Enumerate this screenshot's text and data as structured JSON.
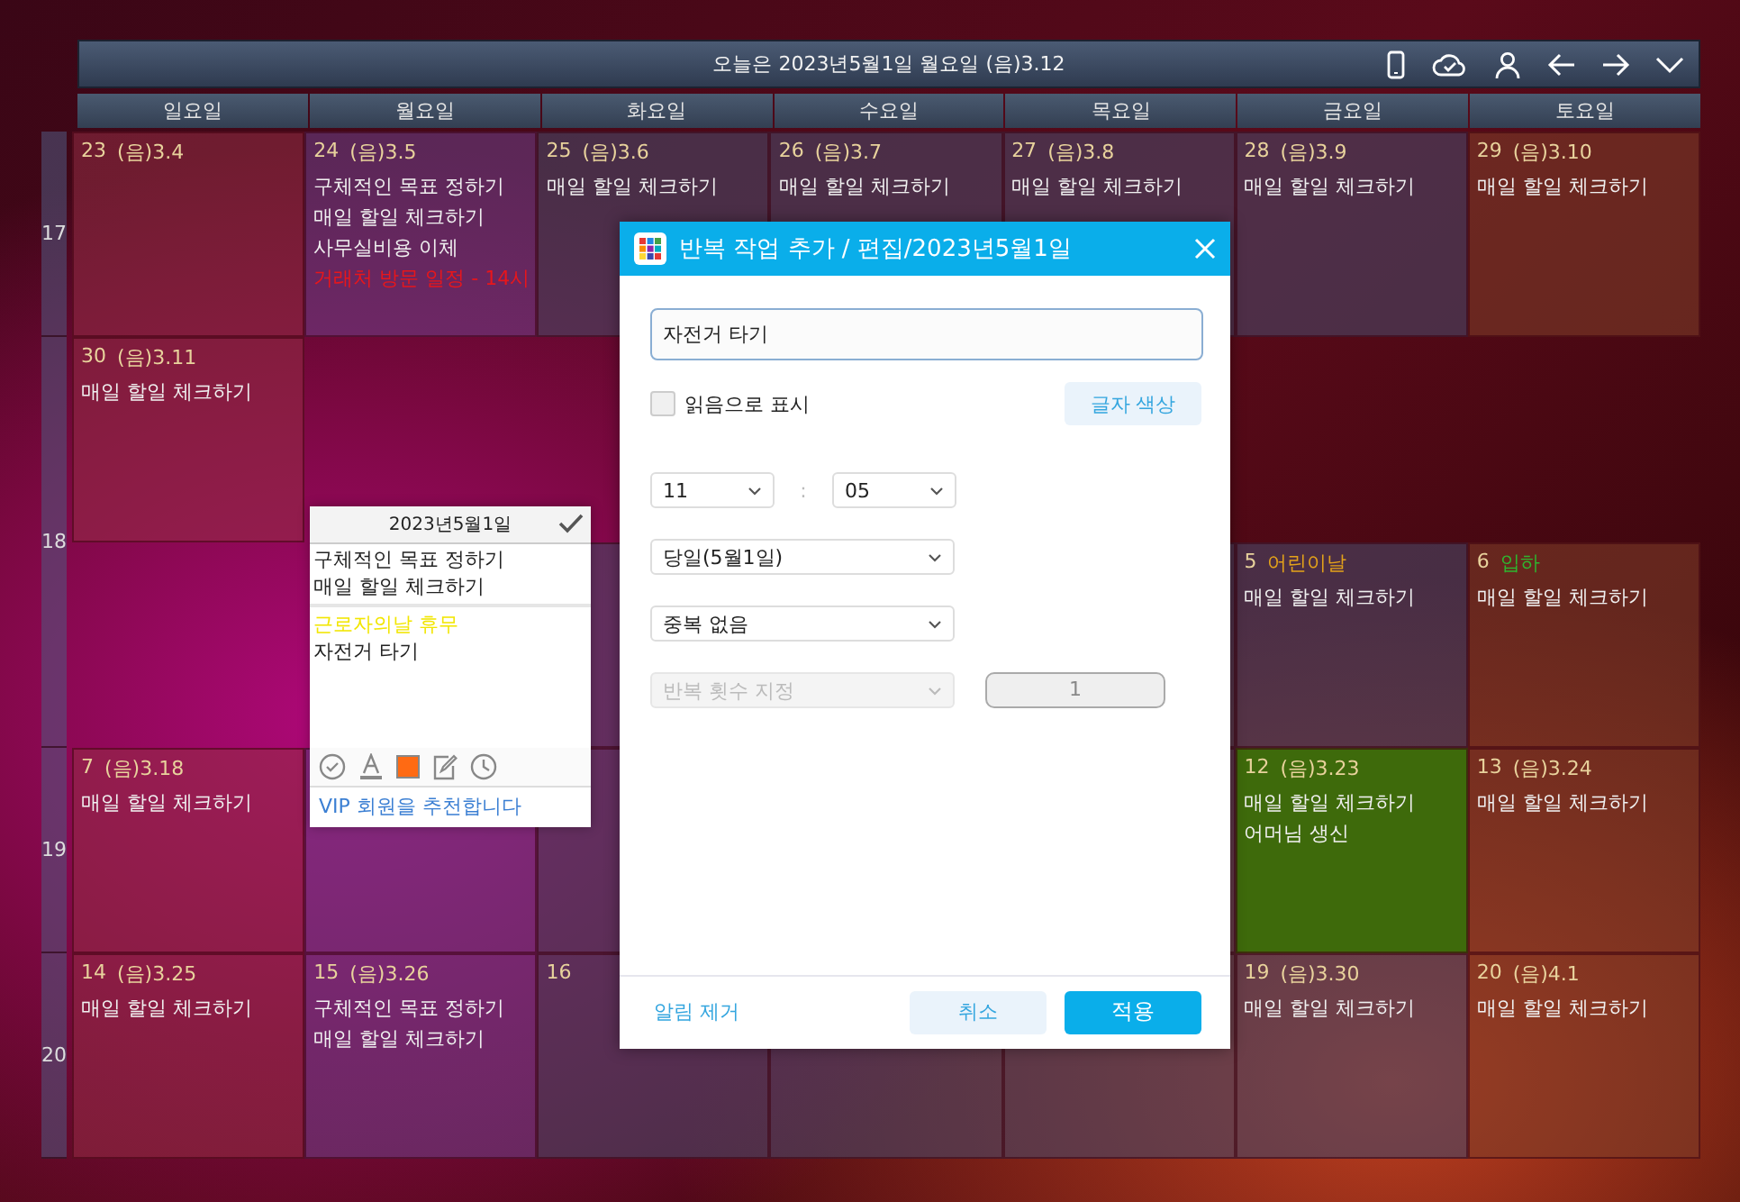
{
  "top_bar": {
    "title": "오늘은 2023년5월1일 월요일 (음)3.12"
  },
  "weekdays": [
    "일요일",
    "월요일",
    "화요일",
    "수요일",
    "목요일",
    "금요일",
    "토요일"
  ],
  "weeks": [
    {
      "number": "17",
      "rows": [
        [
          {
            "kind": "sun",
            "day": "23",
            "sub": "(음)3.4"
          },
          {
            "kind": "mon",
            "day": "24",
            "sub": "(음)3.5",
            "entries": [
              {
                "text": "구체적인 목표 정하기"
              },
              {
                "text": "매일 할일 체크하기"
              },
              {
                "text": "사무실비용 이체"
              },
              {
                "text": "거래처 방문 일정 - 14시",
                "color": "#e8161b"
              }
            ]
          },
          {
            "kind": "mid",
            "day": "25",
            "sub": "(음)3.6",
            "entries": [
              {
                "text": "매일 할일 체크하기"
              }
            ]
          },
          {
            "kind": "mid",
            "day": "26",
            "sub": "(음)3.7",
            "entries": [
              {
                "text": "매일 할일 체크하기"
              }
            ]
          },
          {
            "kind": "mid",
            "day": "27",
            "sub": "(음)3.8",
            "entries": [
              {
                "text": "매일 할일 체크하기"
              }
            ]
          },
          {
            "kind": "mid",
            "day": "28",
            "sub": "(음)3.9",
            "entries": [
              {
                "text": "매일 할일 체크하기"
              }
            ]
          },
          {
            "kind": "sat",
            "day": "29",
            "sub": "(음)3.10",
            "entries": [
              {
                "text": "매일 할일 체크하기"
              }
            ]
          }
        ]
      ]
    },
    {
      "number": "18",
      "rows": [
        [
          {
            "kind": "sun",
            "day": "30",
            "sub": "(음)3.11",
            "entries": [
              {
                "text": "매일 할일 체크하기"
              }
            ]
          },
          {
            "kind": "none"
          },
          {
            "kind": "none"
          },
          {
            "kind": "none"
          },
          {
            "kind": "none"
          },
          {
            "kind": "none"
          },
          {
            "kind": "none"
          }
        ],
        [
          {
            "kind": "none"
          },
          {
            "kind": "none"
          },
          {
            "kind": "mid"
          },
          {
            "kind": "mid"
          },
          {
            "kind": "mid"
          },
          {
            "kind": "mid",
            "day": "5",
            "sub": "어린이날",
            "color": "#e3a21a",
            "entries": [
              {
                "text": "매일 할일 체크하기"
              }
            ]
          },
          {
            "kind": "sat",
            "day": "6",
            "sub": "입하",
            "color": "#2fb52f",
            "entries": [
              {
                "text": "매일 할일 체크하기"
              }
            ]
          }
        ]
      ]
    },
    {
      "number": "19",
      "rows": [
        [
          {
            "kind": "sun",
            "day": "7",
            "sub": "(음)3.18",
            "entries": [
              {
                "text": "매일 할일 체크하기"
              }
            ]
          },
          {
            "kind": "mon"
          },
          {
            "kind": "mid"
          },
          {
            "kind": "mid"
          },
          {
            "kind": "mid"
          },
          {
            "kind": "green",
            "day": "12",
            "sub": "(음)3.23",
            "entries": [
              {
                "text": "매일 할일 체크하기"
              },
              {
                "text": "어머님 생신"
              }
            ]
          },
          {
            "kind": "sat",
            "day": "13",
            "sub": "(음)3.24",
            "entries": [
              {
                "text": "매일 할일 체크하기"
              }
            ]
          }
        ]
      ]
    },
    {
      "number": "20",
      "rows": [
        [
          {
            "kind": "sun",
            "day": "14",
            "sub": "(음)3.25",
            "entries": [
              {
                "text": "매일 할일 체크하기"
              }
            ]
          },
          {
            "kind": "mon",
            "day": "15",
            "sub": "(음)3.26",
            "entries": [
              {
                "text": "구체적인 목표 정하기"
              },
              {
                "text": "매일 할일 체크하기"
              }
            ]
          },
          {
            "kind": "mid",
            "day": "16"
          },
          {
            "kind": "mid"
          },
          {
            "kind": "mid"
          },
          {
            "kind": "mid",
            "day": "19",
            "sub": "(음)3.30",
            "entries": [
              {
                "text": "매일 할일 체크하기"
              }
            ]
          },
          {
            "kind": "sat",
            "day": "20",
            "sub": "(음)4.1",
            "entries": [
              {
                "text": "매일 할일 체크하기"
              }
            ]
          }
        ]
      ]
    }
  ],
  "note": {
    "title": "2023년5월1일",
    "top_lines": [
      "구체적인 목표 정하기",
      "매일 할일 체크하기"
    ],
    "lines": [
      {
        "text": "근로자의날 휴무",
        "color": "#f2e600"
      },
      {
        "text": "자전거 타기"
      }
    ],
    "link": "VIP 회원을 추천합니다"
  },
  "dialog": {
    "title": "반복 작업 추가 / 편집/2023년5월1일",
    "task_field": {
      "value": "자전거 타기"
    },
    "mark_read": {
      "label": "읽음으로 표시",
      "checked": false
    },
    "color_button": "글자 색상",
    "hour": {
      "value": "11"
    },
    "time_separator": ":",
    "minute": {
      "value": "05"
    },
    "day_select": {
      "value": "당일(5월1일)",
      "disabled": false
    },
    "repeat_select": {
      "value": "중복 없음",
      "disabled": false
    },
    "count_select": {
      "value": "반복 횟수 지정",
      "disabled": true
    },
    "count_field": {
      "value": "1",
      "disabled": true
    },
    "remove_link": "알림 제거",
    "cancel_button": "취소",
    "apply_button": "적용"
  }
}
